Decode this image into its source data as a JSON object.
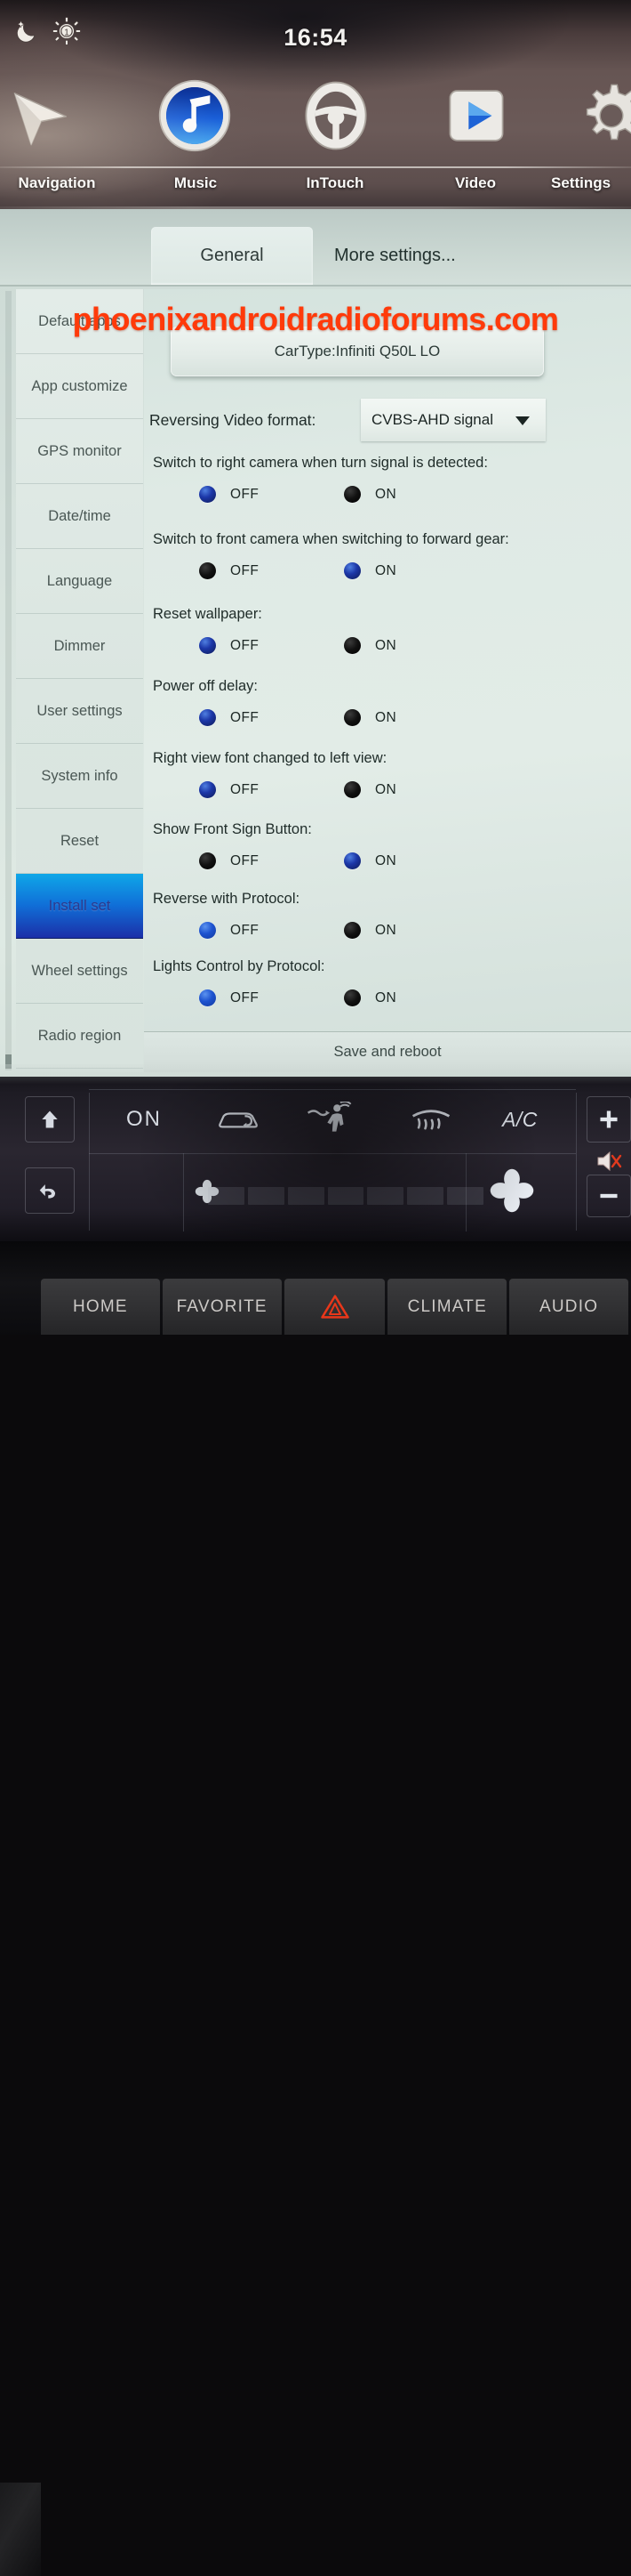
{
  "statusbar": {
    "night_mode_icon": "moon-star-icon",
    "brightness_icon": "sun-brightness-icon",
    "brightness_level": "1",
    "time": "16:54"
  },
  "appbar": {
    "items": [
      {
        "label": "Navigation",
        "icon": "navigation-arrow-icon"
      },
      {
        "label": "Music",
        "icon": "music-note-icon"
      },
      {
        "label": "InTouch",
        "icon": "steering-wheel-icon"
      },
      {
        "label": "Video",
        "icon": "play-button-icon"
      },
      {
        "label": "Settings",
        "icon": "gear-icon"
      }
    ]
  },
  "settings": {
    "tabs": [
      {
        "label": "General",
        "selected": true
      },
      {
        "label": "More settings...",
        "selected": false
      }
    ],
    "sidebar": {
      "items": [
        {
          "label": "Default apps",
          "selected": false
        },
        {
          "label": "App customize",
          "selected": false
        },
        {
          "label": "GPS monitor",
          "selected": false
        },
        {
          "label": "Date/time",
          "selected": false
        },
        {
          "label": "Language",
          "selected": false
        },
        {
          "label": "Dimmer",
          "selected": false
        },
        {
          "label": "User settings",
          "selected": false
        },
        {
          "label": "System info",
          "selected": false
        },
        {
          "label": "Reset",
          "selected": false
        },
        {
          "label": "Install set",
          "selected": true
        },
        {
          "label": "Wheel settings",
          "selected": false
        },
        {
          "label": "Radio region",
          "selected": false
        }
      ]
    },
    "car_type_button": "CarType:Infiniti Q50L LO",
    "reversing_video_format": {
      "label": "Reversing Video format:",
      "value": "CVBS-AHD signal"
    },
    "options": [
      {
        "question": "Switch to right camera when turn signal is detected:",
        "off_label": "OFF",
        "on_label": "ON",
        "selected": "OFF"
      },
      {
        "question": "Switch to front camera when switching to forward gear:",
        "off_label": "OFF",
        "on_label": "ON",
        "selected": "ON"
      },
      {
        "question": "Reset wallpaper:",
        "off_label": "OFF",
        "on_label": "ON",
        "selected": "OFF"
      },
      {
        "question": "Power off delay:",
        "off_label": "OFF",
        "on_label": "ON",
        "selected": "OFF"
      },
      {
        "question": "Right view font changed to left view:",
        "off_label": "OFF",
        "on_label": "ON",
        "selected": "OFF"
      },
      {
        "question": "Show Front Sign Button:",
        "off_label": "OFF",
        "on_label": "ON",
        "selected": "ON"
      },
      {
        "question": "Reverse with Protocol:",
        "off_label": "OFF",
        "on_label": "ON",
        "selected": "OFF"
      },
      {
        "question": "Lights Control by Protocol:",
        "off_label": "OFF",
        "on_label": "ON",
        "selected": "OFF"
      }
    ],
    "save_button": "Save and reboot"
  },
  "watermark": "phoenixandroidradioforums.com",
  "climate": {
    "up_icon": "up-arrow-icon",
    "back_icon": "back-arrow-icon",
    "power_label": "ON",
    "recirculate_icon": "air-recirculation-icon",
    "airflow_icon": "airflow-body-feet-icon",
    "defrost_icon": "rear-defrost-icon",
    "ac_label": "A/C",
    "plus_icon": "plus-icon",
    "minus_icon": "minus-icon",
    "mute_icon": "mute-speaker-icon",
    "fan_low_icon": "fan-low-icon",
    "fan_high_icon": "fan-high-icon"
  },
  "hardware_bar": {
    "buttons": [
      {
        "label": "HOME",
        "icon": ""
      },
      {
        "label": "FAVORITE",
        "icon": ""
      },
      {
        "label": "",
        "icon": "hazard-triangle-icon"
      },
      {
        "label": "CLIMATE",
        "icon": ""
      },
      {
        "label": "AUDIO",
        "icon": ""
      }
    ]
  },
  "colors": {
    "watermark": "#ff3a0a",
    "selected_sidebar_start": "#0fa7e8",
    "selected_sidebar_end": "#1b2fa8",
    "radio_selected": "#1c37a8",
    "radio_unselected": "#000000",
    "hazard": "#e8371a"
  }
}
